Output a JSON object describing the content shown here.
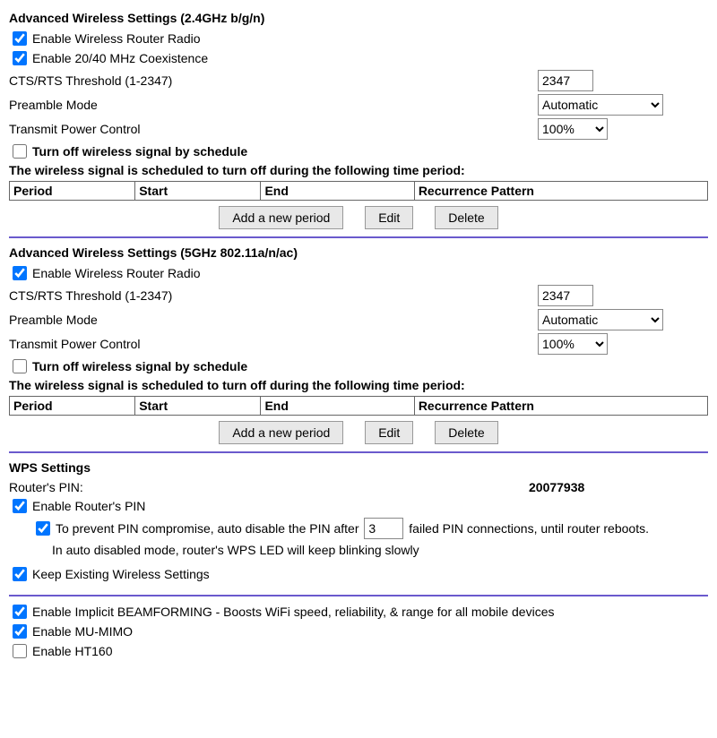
{
  "s24": {
    "title": "Advanced Wireless Settings (2.4GHz b/g/n)",
    "enable_radio_label": "Enable Wireless Router Radio",
    "enable_coex_label": "Enable 20/40 MHz Coexistence",
    "cts_label": "CTS/RTS Threshold (1-2347)",
    "cts_value": "2347",
    "preamble_label": "Preamble Mode",
    "preamble_value": "Automatic",
    "tx_label": "Transmit Power Control",
    "tx_value": "100%",
    "turnoff_label": "Turn off wireless signal by schedule",
    "sched_text": "The wireless signal is scheduled to turn off during the following time period:",
    "cols": {
      "period": "Period",
      "start": "Start",
      "end": "End",
      "rec": "Recurrence Pattern"
    },
    "btn_add": "Add a new period",
    "btn_edit": "Edit",
    "btn_delete": "Delete"
  },
  "s5": {
    "title": "Advanced Wireless Settings (5GHz 802.11a/n/ac)",
    "enable_radio_label": "Enable Wireless Router Radio",
    "cts_label": "CTS/RTS Threshold (1-2347)",
    "cts_value": "2347",
    "preamble_label": "Preamble Mode",
    "preamble_value": "Automatic",
    "tx_label": "Transmit Power Control",
    "tx_value": "100%",
    "turnoff_label": "Turn off wireless signal by schedule",
    "sched_text": "The wireless signal is scheduled to turn off during the following time period:",
    "cols": {
      "period": "Period",
      "start": "Start",
      "end": "End",
      "rec": "Recurrence Pattern"
    },
    "btn_add": "Add a new period",
    "btn_edit": "Edit",
    "btn_delete": "Delete"
  },
  "wps": {
    "title": "WPS Settings",
    "pin_label": "Router's PIN:",
    "pin_value": "20077938",
    "enable_pin_label": "Enable Router's PIN",
    "autodisable_pre": "To prevent PIN compromise, auto disable the PIN after",
    "autodisable_value": "3",
    "autodisable_post": "failed PIN connections, until router reboots.",
    "autodisable_note": "In auto disabled mode, router's WPS LED will keep blinking slowly",
    "keep_label": "Keep Existing Wireless Settings"
  },
  "adv": {
    "beamforming_label": "Enable Implicit BEAMFORMING - Boosts WiFi speed, reliability, & range for all mobile devices",
    "mumimo_label": "Enable MU-MIMO",
    "ht160_label": "Enable HT160"
  }
}
